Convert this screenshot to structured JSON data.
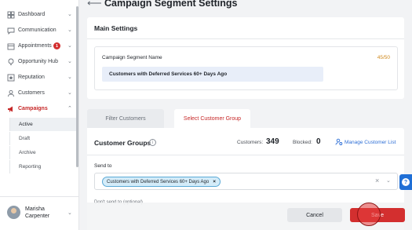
{
  "sidebar": {
    "items": [
      {
        "label": "Dashboard",
        "icon": "dashboard-icon",
        "badge": null
      },
      {
        "label": "Communication",
        "icon": "chat-icon",
        "badge": null
      },
      {
        "label": "Appointments",
        "icon": "calendar-icon",
        "badge": "1"
      },
      {
        "label": "Opportunity Hub",
        "icon": "lightbulb-icon",
        "badge": null
      },
      {
        "label": "Reputation",
        "icon": "star-icon",
        "badge": null
      },
      {
        "label": "Customers",
        "icon": "person-icon",
        "badge": null
      },
      {
        "label": "Campaigns",
        "icon": "megaphone-icon",
        "badge": null
      }
    ],
    "sub_items": [
      "Active",
      "Draft",
      "Archive",
      "Reporting"
    ],
    "selected_sub_item": "Active",
    "user": {
      "first": "Marisha",
      "last": "Carpenter"
    }
  },
  "header": {
    "title": "Campaign Segment Settings"
  },
  "main_settings": {
    "title": "Main Settings",
    "name_label": "Campaign Segment Name",
    "char_count": "45/50",
    "name_value": "Customers with Deferred Services 60+ Days Ago"
  },
  "tabs": [
    {
      "label": "Filter Customers",
      "active": false
    },
    {
      "label": "Select Customer Group",
      "active": true
    }
  ],
  "customer_groups": {
    "title": "Customer Groups",
    "customers_label": "Customers:",
    "customers_value": "349",
    "blocked_label": "Blocked:",
    "blocked_value": "0",
    "manage_label": "Manage Customer List",
    "send_to_label": "Send to",
    "send_to_chip": "Customers with Deferred Services 60+ Days Ago",
    "dont_send_label": "Don't send to (optional)"
  },
  "footer": {
    "cancel_label": "Cancel",
    "save_label": "Save"
  },
  "colors": {
    "accent": "#c62828",
    "link": "#2e6fd6",
    "input_bg": "#e8eef9"
  }
}
